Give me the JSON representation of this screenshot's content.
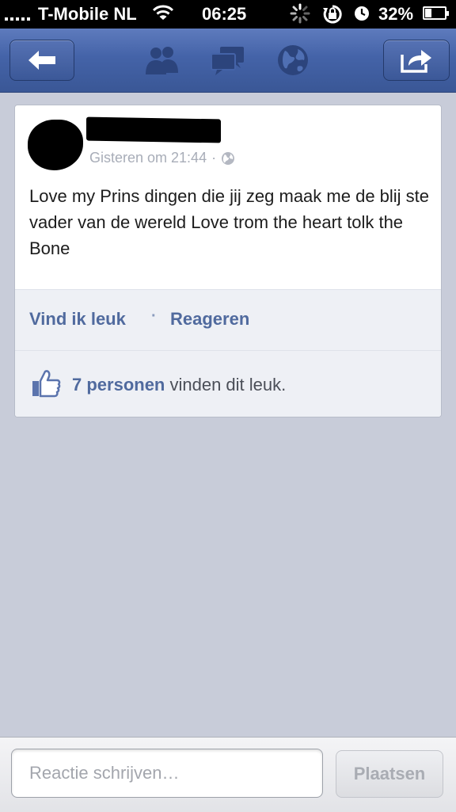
{
  "status_bar": {
    "carrier": "T-Mobile NL",
    "time": "06:25",
    "battery_percent": "32%",
    "battery_level": 0.32,
    "icons": [
      "signal-dots-icon",
      "wifi-icon",
      "activity-spinner-icon",
      "rotation-lock-icon",
      "alarm-icon",
      "battery-icon"
    ]
  },
  "nav": {
    "icons": [
      "back-arrow-icon",
      "friends-icon",
      "messages-icon",
      "globe-icon",
      "share-icon"
    ],
    "accent": "#3b5998"
  },
  "post": {
    "timestamp": "Gisteren om 21:44",
    "meta_separator": "·",
    "privacy_icon": "globe-icon",
    "text": "Love my Prins dingen die jij zeg maak me de blij ste vader van de wereld Love trom the heart tolk the Bone",
    "actions": {
      "like": "Vind ik leuk",
      "separator": "·",
      "comment": "Reageren"
    },
    "likes": {
      "count_text": "7 personen",
      "suffix": " vinden dit leuk."
    }
  },
  "comment_bar": {
    "placeholder": "Reactie schrijven…",
    "submit_label": "Plaatsen"
  },
  "colors": {
    "link": "#506a9e",
    "background": "#c8ccd9",
    "nav_bar": "#4463a8"
  }
}
